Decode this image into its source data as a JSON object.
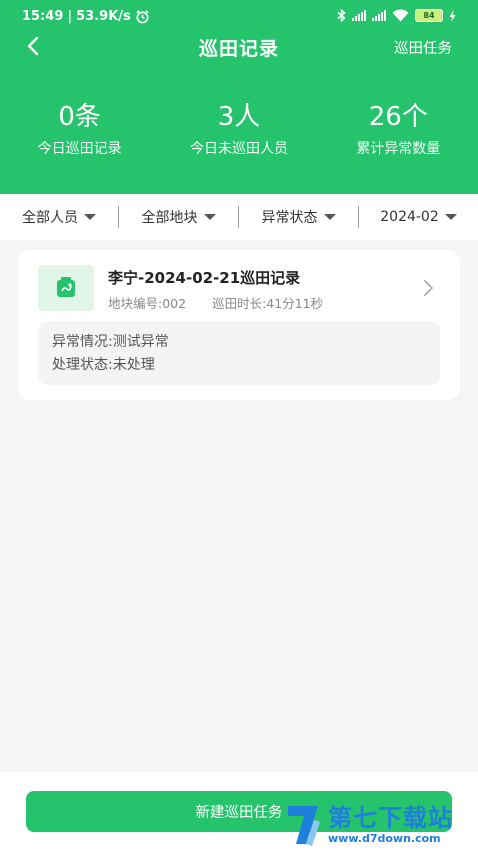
{
  "status_bar": {
    "time": "15:49",
    "network_speed": "53.9K/s",
    "battery": "84"
  },
  "nav": {
    "title": "巡田记录",
    "action": "巡田任务"
  },
  "stats": [
    {
      "value": "0条",
      "label": "今日巡田记录"
    },
    {
      "value": "3人",
      "label": "今日未巡田人员"
    },
    {
      "value": "26个",
      "label": "累计异常数量"
    }
  ],
  "filters": {
    "personnel": "全部人员",
    "plot": "全部地块",
    "abnormal_status": "异常状态",
    "month": "2024-02"
  },
  "records": [
    {
      "title": "李宁-2024-02-21巡田记录",
      "plot_no": "地块编号:002",
      "duration": "巡田时长:41分11秒",
      "abnormal": "异常情况:测试异常",
      "handle_status": "处理状态:未处理"
    }
  ],
  "footer": {
    "create_button": "新建巡田任务"
  },
  "watermark": {
    "title": "第七下载站",
    "url": "www.d7down.com"
  },
  "colors": {
    "primary": "#25c46c",
    "background": "#f4f5f7",
    "watermark": "#1f7fdc"
  }
}
